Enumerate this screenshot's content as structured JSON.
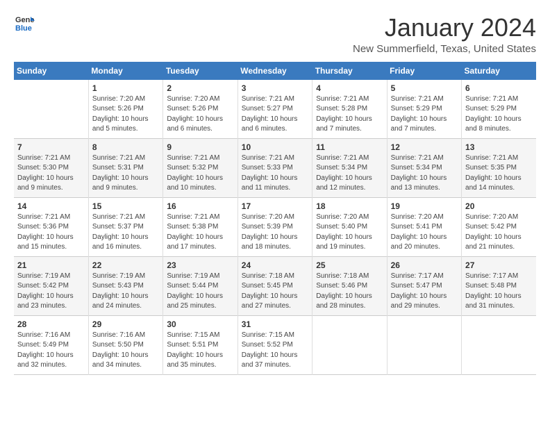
{
  "logo": {
    "general": "General",
    "blue": "Blue"
  },
  "header": {
    "title": "January 2024",
    "subtitle": "New Summerfield, Texas, United States"
  },
  "days_of_week": [
    "Sunday",
    "Monday",
    "Tuesday",
    "Wednesday",
    "Thursday",
    "Friday",
    "Saturday"
  ],
  "weeks": [
    [
      {
        "day": "",
        "info": ""
      },
      {
        "day": "1",
        "info": "Sunrise: 7:20 AM\nSunset: 5:26 PM\nDaylight: 10 hours\nand 5 minutes."
      },
      {
        "day": "2",
        "info": "Sunrise: 7:20 AM\nSunset: 5:26 PM\nDaylight: 10 hours\nand 6 minutes."
      },
      {
        "day": "3",
        "info": "Sunrise: 7:21 AM\nSunset: 5:27 PM\nDaylight: 10 hours\nand 6 minutes."
      },
      {
        "day": "4",
        "info": "Sunrise: 7:21 AM\nSunset: 5:28 PM\nDaylight: 10 hours\nand 7 minutes."
      },
      {
        "day": "5",
        "info": "Sunrise: 7:21 AM\nSunset: 5:29 PM\nDaylight: 10 hours\nand 7 minutes."
      },
      {
        "day": "6",
        "info": "Sunrise: 7:21 AM\nSunset: 5:29 PM\nDaylight: 10 hours\nand 8 minutes."
      }
    ],
    [
      {
        "day": "7",
        "info": "Sunrise: 7:21 AM\nSunset: 5:30 PM\nDaylight: 10 hours\nand 9 minutes."
      },
      {
        "day": "8",
        "info": "Sunrise: 7:21 AM\nSunset: 5:31 PM\nDaylight: 10 hours\nand 9 minutes."
      },
      {
        "day": "9",
        "info": "Sunrise: 7:21 AM\nSunset: 5:32 PM\nDaylight: 10 hours\nand 10 minutes."
      },
      {
        "day": "10",
        "info": "Sunrise: 7:21 AM\nSunset: 5:33 PM\nDaylight: 10 hours\nand 11 minutes."
      },
      {
        "day": "11",
        "info": "Sunrise: 7:21 AM\nSunset: 5:34 PM\nDaylight: 10 hours\nand 12 minutes."
      },
      {
        "day": "12",
        "info": "Sunrise: 7:21 AM\nSunset: 5:34 PM\nDaylight: 10 hours\nand 13 minutes."
      },
      {
        "day": "13",
        "info": "Sunrise: 7:21 AM\nSunset: 5:35 PM\nDaylight: 10 hours\nand 14 minutes."
      }
    ],
    [
      {
        "day": "14",
        "info": "Sunrise: 7:21 AM\nSunset: 5:36 PM\nDaylight: 10 hours\nand 15 minutes."
      },
      {
        "day": "15",
        "info": "Sunrise: 7:21 AM\nSunset: 5:37 PM\nDaylight: 10 hours\nand 16 minutes."
      },
      {
        "day": "16",
        "info": "Sunrise: 7:21 AM\nSunset: 5:38 PM\nDaylight: 10 hours\nand 17 minutes."
      },
      {
        "day": "17",
        "info": "Sunrise: 7:20 AM\nSunset: 5:39 PM\nDaylight: 10 hours\nand 18 minutes."
      },
      {
        "day": "18",
        "info": "Sunrise: 7:20 AM\nSunset: 5:40 PM\nDaylight: 10 hours\nand 19 minutes."
      },
      {
        "day": "19",
        "info": "Sunrise: 7:20 AM\nSunset: 5:41 PM\nDaylight: 10 hours\nand 20 minutes."
      },
      {
        "day": "20",
        "info": "Sunrise: 7:20 AM\nSunset: 5:42 PM\nDaylight: 10 hours\nand 21 minutes."
      }
    ],
    [
      {
        "day": "21",
        "info": "Sunrise: 7:19 AM\nSunset: 5:42 PM\nDaylight: 10 hours\nand 23 minutes."
      },
      {
        "day": "22",
        "info": "Sunrise: 7:19 AM\nSunset: 5:43 PM\nDaylight: 10 hours\nand 24 minutes."
      },
      {
        "day": "23",
        "info": "Sunrise: 7:19 AM\nSunset: 5:44 PM\nDaylight: 10 hours\nand 25 minutes."
      },
      {
        "day": "24",
        "info": "Sunrise: 7:18 AM\nSunset: 5:45 PM\nDaylight: 10 hours\nand 27 minutes."
      },
      {
        "day": "25",
        "info": "Sunrise: 7:18 AM\nSunset: 5:46 PM\nDaylight: 10 hours\nand 28 minutes."
      },
      {
        "day": "26",
        "info": "Sunrise: 7:17 AM\nSunset: 5:47 PM\nDaylight: 10 hours\nand 29 minutes."
      },
      {
        "day": "27",
        "info": "Sunrise: 7:17 AM\nSunset: 5:48 PM\nDaylight: 10 hours\nand 31 minutes."
      }
    ],
    [
      {
        "day": "28",
        "info": "Sunrise: 7:16 AM\nSunset: 5:49 PM\nDaylight: 10 hours\nand 32 minutes."
      },
      {
        "day": "29",
        "info": "Sunrise: 7:16 AM\nSunset: 5:50 PM\nDaylight: 10 hours\nand 34 minutes."
      },
      {
        "day": "30",
        "info": "Sunrise: 7:15 AM\nSunset: 5:51 PM\nDaylight: 10 hours\nand 35 minutes."
      },
      {
        "day": "31",
        "info": "Sunrise: 7:15 AM\nSunset: 5:52 PM\nDaylight: 10 hours\nand 37 minutes."
      },
      {
        "day": "",
        "info": ""
      },
      {
        "day": "",
        "info": ""
      },
      {
        "day": "",
        "info": ""
      }
    ]
  ]
}
